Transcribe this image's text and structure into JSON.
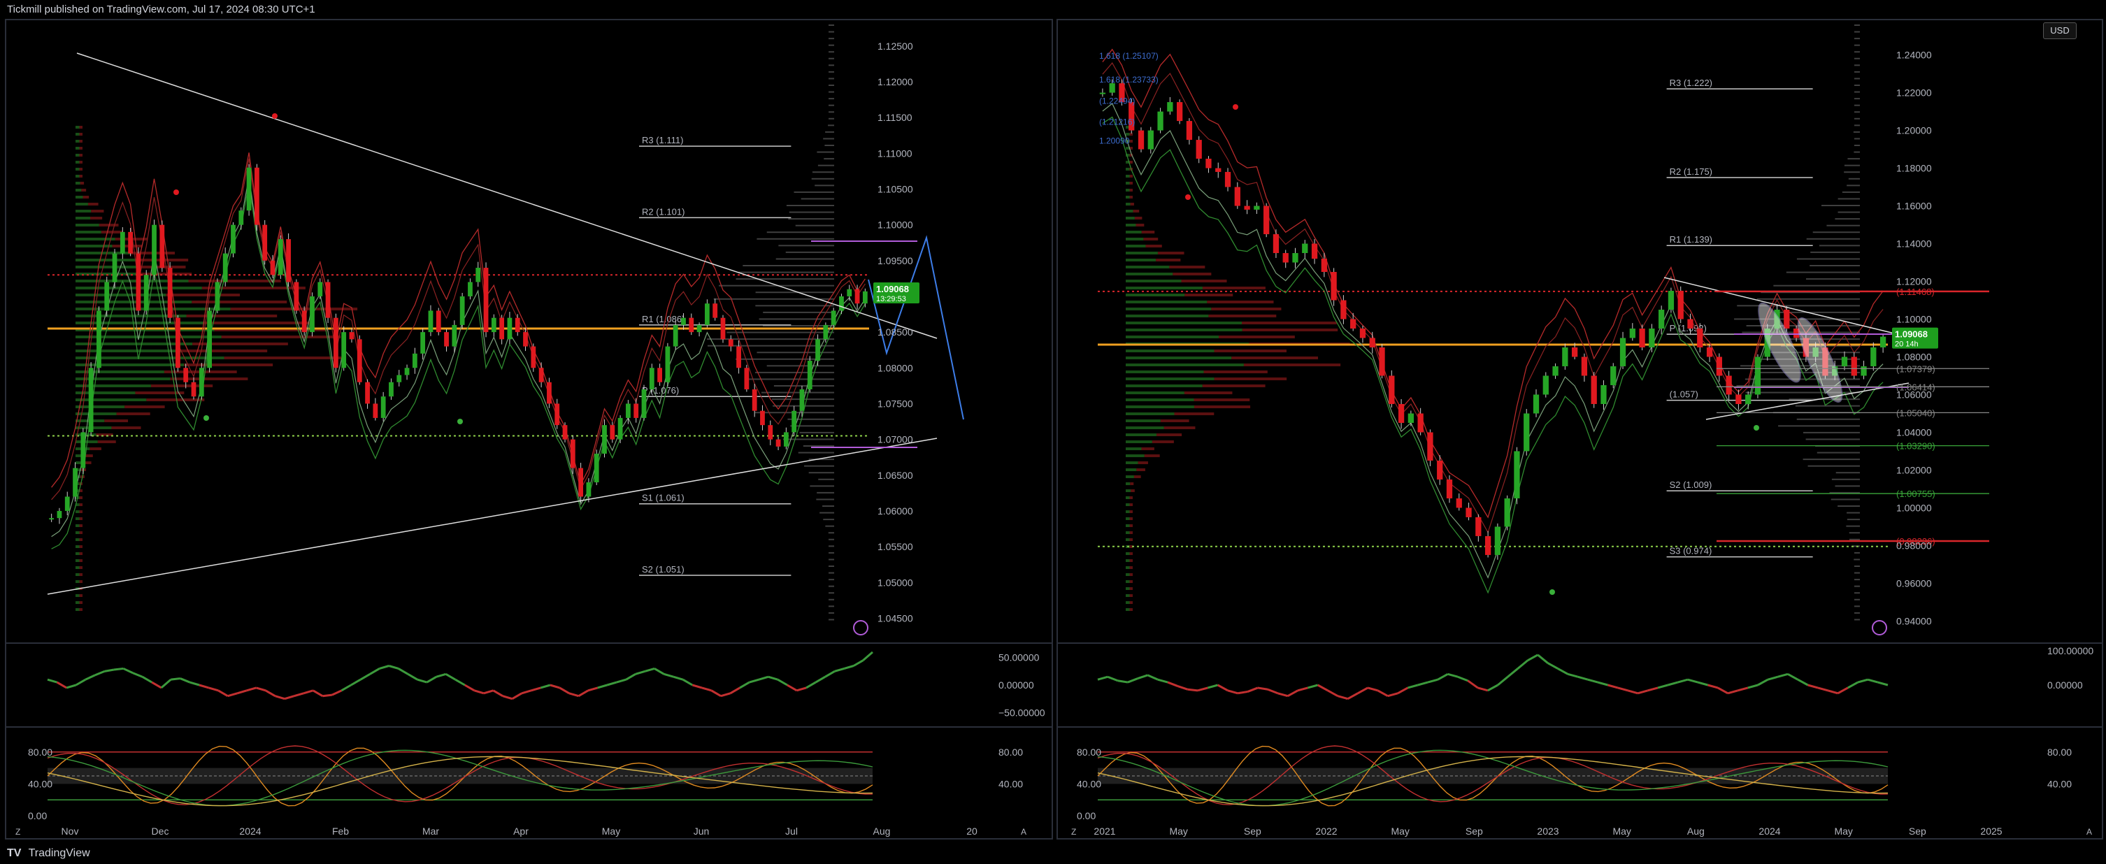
{
  "header": {
    "published": "Tickmill published on TradingView.com, Jul 17, 2024 08:30 UTC+1"
  },
  "footer": {
    "brand": "TradingView"
  },
  "colors": {
    "bg": "#000000",
    "panel_border": "#2a2e39",
    "up": "#26a626",
    "down": "#e0191f",
    "poc": "#f0a020",
    "pivot_line": "#c8c8c8",
    "green_dotted": "#8ed14a",
    "red_dotted": "#d9262b",
    "purple": "#b15cd9",
    "blue": "#3d7de8",
    "price_tag": "#1e9e1e"
  },
  "chart_data": [
    {
      "type": "candlestick",
      "name": "left",
      "y_ticks": [
        "1.12500",
        "1.12000",
        "1.11500",
        "1.11000",
        "1.10500",
        "1.10000",
        "1.09500",
        "1.09000",
        "1.08500",
        "1.08000",
        "1.07500",
        "1.07000",
        "1.06500",
        "1.06000",
        "1.05500",
        "1.05000",
        "1.04500"
      ],
      "x_ticks": [
        "Nov",
        "Dec",
        "2024",
        "Feb",
        "Mar",
        "Apr",
        "May",
        "Jun",
        "Jul",
        "Aug",
        "20"
      ],
      "ylim": [
        1.0425,
        1.1285
      ],
      "pivots": [
        {
          "label": "R3 (1.111)",
          "value": 1.111
        },
        {
          "label": "R2 (1.101)",
          "value": 1.101
        },
        {
          "label": "R1 (1.086)",
          "value": 1.086
        },
        {
          "label": "P (1.076)",
          "value": 1.076
        },
        {
          "label": "S1 (1.061)",
          "value": 1.061
        },
        {
          "label": "S2 (1.051)",
          "value": 1.051
        }
      ],
      "poc": 1.0855,
      "red_dotted": 1.093,
      "green_dotted": 1.0705,
      "last_price": "1.09068",
      "countdown": "13:29:53",
      "close": [
        1.059,
        1.06,
        1.062,
        1.066,
        1.071,
        1.08,
        1.088,
        1.092,
        1.096,
        1.099,
        1.096,
        1.088,
        1.093,
        1.1,
        1.094,
        1.087,
        1.08,
        1.078,
        1.076,
        1.08,
        1.088,
        1.092,
        1.096,
        1.1,
        1.102,
        1.108,
        1.1,
        1.095,
        1.093,
        1.098,
        1.092,
        1.088,
        1.085,
        1.09,
        1.092,
        1.087,
        1.08,
        1.085,
        1.084,
        1.078,
        1.075,
        1.073,
        1.076,
        1.078,
        1.079,
        1.08,
        1.082,
        1.085,
        1.088,
        1.085,
        1.083,
        1.086,
        1.09,
        1.092,
        1.094,
        1.085,
        1.087,
        1.084,
        1.087,
        1.085,
        1.083,
        1.08,
        1.078,
        1.075,
        1.072,
        1.07,
        1.066,
        1.062,
        1.064,
        1.068,
        1.072,
        1.07,
        1.073,
        1.075,
        1.073,
        1.077,
        1.08,
        1.078,
        1.083,
        1.086,
        1.087,
        1.085,
        1.086,
        1.089,
        1.087,
        1.084,
        1.083,
        1.08,
        1.077,
        1.074,
        1.072,
        1.07,
        1.069,
        1.071,
        1.074,
        1.077,
        1.081,
        1.084,
        1.086,
        1.088,
        1.09,
        1.091,
        1.089,
        1.0907
      ]
    },
    {
      "type": "candlestick",
      "name": "right",
      "y_ticks": [
        "1.24000",
        "1.22000",
        "1.20000",
        "1.18000",
        "1.16000",
        "1.14000",
        "1.12000",
        "1.10000",
        "1.08000",
        "1.06000",
        "1.04000",
        "1.02000",
        "1.00000",
        "0.98000",
        "0.96000",
        "0.94000"
      ],
      "x_ticks": [
        "2021",
        "May",
        "Sep",
        "2022",
        "May",
        "Sep",
        "2023",
        "May",
        "Aug",
        "2024",
        "May",
        "Sep",
        "2025"
      ],
      "ylim": [
        0.932,
        1.258
      ],
      "pivots": [
        {
          "label": "R3 (1.222)",
          "value": 1.222
        },
        {
          "label": "R2 (1.175)",
          "value": 1.175
        },
        {
          "label": "R1 (1.139)",
          "value": 1.139
        },
        {
          "label": "P (1.092)",
          "value": 1.092
        },
        {
          "label": "(1.057)",
          "value": 1.057
        },
        {
          "label": "S2 (1.009)",
          "value": 1.009
        },
        {
          "label": "S3 (0.974)",
          "value": 0.974
        }
      ],
      "fib_levels": [
        {
          "label": "(1.11468)",
          "value": 1.11468,
          "color": "#d9262b"
        },
        {
          "label": "(1.07379)",
          "value": 1.07379,
          "color": "#888888"
        },
        {
          "label": "(1.06414)",
          "value": 1.06414,
          "color": "#888888"
        },
        {
          "label": "(1.05040)",
          "value": 1.0504,
          "color": "#888888"
        },
        {
          "label": "(1.03290)",
          "value": 1.0329,
          "color": "#3aa63a"
        },
        {
          "label": "(1.00755)",
          "value": 1.00755,
          "color": "#3aa63a"
        },
        {
          "label": "(0.98236)",
          "value": 0.98236,
          "color": "#d9262b"
        }
      ],
      "fib_top": [
        {
          "label": "1.618 (1.25107)",
          "value": 1.2395
        },
        {
          "label": "1.618 (1.23733)",
          "value": 1.2268
        },
        {
          "label": "(1.22494)",
          "value": 1.2155
        },
        {
          "label": "(1.21216)",
          "value": 1.2045
        },
        {
          "label": "1.20090",
          "value": 1.1945
        }
      ],
      "poc": 1.0865,
      "red_dotted": 1.1147,
      "green_dotted": 0.9795,
      "last_price": "1.09068",
      "countdown": "20 14h",
      "close": [
        1.22,
        1.225,
        1.215,
        1.2,
        1.19,
        1.2,
        1.21,
        1.215,
        1.205,
        1.195,
        1.185,
        1.18,
        1.178,
        1.17,
        1.16,
        1.158,
        1.16,
        1.145,
        1.135,
        1.13,
        1.135,
        1.14,
        1.132,
        1.125,
        1.11,
        1.1,
        1.095,
        1.09,
        1.085,
        1.07,
        1.055,
        1.045,
        1.05,
        1.04,
        1.025,
        1.015,
        1.005,
        1.0,
        0.995,
        0.985,
        0.975,
        0.99,
        1.005,
        1.03,
        1.05,
        1.06,
        1.07,
        1.075,
        1.085,
        1.08,
        1.07,
        1.055,
        1.065,
        1.075,
        1.09,
        1.095,
        1.085,
        1.095,
        1.105,
        1.115,
        1.1,
        1.095,
        1.085,
        1.08,
        1.07,
        1.06,
        1.055,
        1.06,
        1.08,
        1.095,
        1.105,
        1.095,
        1.09,
        1.08,
        1.085,
        1.07,
        1.075,
        1.08,
        1.07,
        1.075,
        1.085,
        1.0907
      ]
    }
  ],
  "left_osc1": {
    "ticks": [
      "50.00000",
      "0.00000",
      "−50.00000"
    ],
    "values": [
      10,
      5,
      -5,
      0,
      10,
      18,
      25,
      28,
      30,
      22,
      15,
      5,
      -5,
      10,
      12,
      5,
      0,
      -5,
      -10,
      -20,
      -15,
      -10,
      -5,
      -10,
      -20,
      -25,
      -20,
      -15,
      -10,
      -20,
      -18,
      -10,
      0,
      10,
      20,
      30,
      35,
      30,
      20,
      10,
      5,
      15,
      20,
      10,
      0,
      -10,
      -15,
      -10,
      -20,
      -25,
      -15,
      -10,
      -5,
      0,
      -5,
      -15,
      -20,
      -10,
      -5,
      0,
      5,
      10,
      20,
      25,
      30,
      20,
      15,
      10,
      0,
      -5,
      -10,
      -20,
      -15,
      -5,
      5,
      10,
      15,
      10,
      0,
      -10,
      -5,
      5,
      15,
      25,
      30,
      35,
      45,
      60
    ]
  },
  "left_osc2": {
    "ticks": [
      "80.00",
      "40.00",
      "0.00"
    ],
    "right_ticks": [
      "80.00",
      "40.00"
    ]
  },
  "right_osc1": {
    "ticks": [
      "100.00000",
      "0.00000"
    ],
    "values": [
      10,
      15,
      8,
      5,
      12,
      18,
      10,
      5,
      -2,
      -8,
      -10,
      -5,
      0,
      -10,
      -15,
      -12,
      -5,
      -8,
      -15,
      -20,
      -10,
      -5,
      0,
      -10,
      -20,
      -25,
      -15,
      -5,
      -10,
      -20,
      -15,
      -5,
      0,
      5,
      10,
      20,
      15,
      8,
      -5,
      -10,
      0,
      15,
      30,
      45,
      55,
      40,
      30,
      20,
      15,
      10,
      5,
      0,
      -5,
      -10,
      -15,
      -10,
      -5,
      0,
      5,
      10,
      5,
      0,
      -5,
      -15,
      -10,
      -5,
      0,
      10,
      15,
      20,
      10,
      0,
      -5,
      -10,
      -15,
      -5,
      5,
      10,
      5,
      0
    ]
  },
  "right_osc2": {
    "ticks": [
      "80.00",
      "40.00",
      "0.00"
    ],
    "right_ticks": [
      "80.00",
      "40.00"
    ]
  },
  "ui": {
    "currency": "USD",
    "scale_a": "A",
    "tz_z": "Z"
  }
}
